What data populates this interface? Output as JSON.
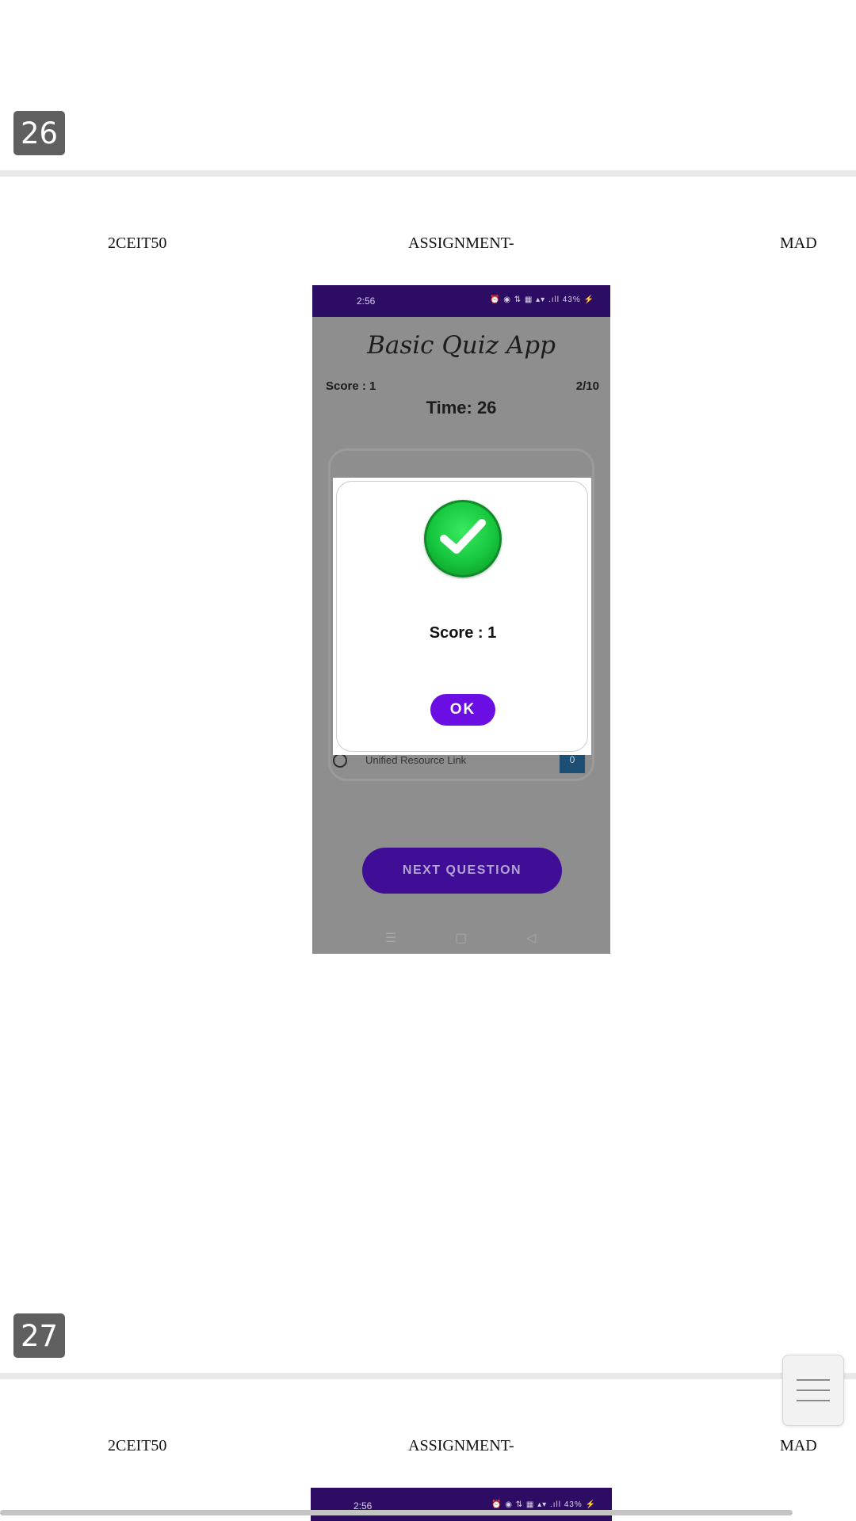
{
  "pages": [
    {
      "number": "26",
      "header": {
        "left": "2CEIT50",
        "center": "ASSIGNMENT-",
        "right": "MAD"
      }
    },
    {
      "number": "27",
      "header": {
        "left": "2CEIT50",
        "center": "ASSIGNMENT-",
        "right": "MAD"
      }
    }
  ],
  "screenshot1": {
    "status_time": "2:56",
    "status_icons": "⏰ ◉ ⇅ ▦ ▴▾ .ıll 43% ⚡",
    "app_title": "Basic Quiz App",
    "score_label": "Score : 1",
    "progress": "2/10",
    "timer": "Time: 26",
    "last_option": {
      "text": "Unified Resource Link",
      "tag": "0"
    },
    "next_button": "NEXT QUESTION",
    "nav_icons": {
      "menu": "☰",
      "home": "▢",
      "back": "◁"
    },
    "dialog": {
      "icon": "check-icon",
      "score": "Score : 1",
      "ok_label": "OK"
    }
  },
  "screenshot2": {
    "status_time": "2:56",
    "status_icons": "⏰ ◉ ⇅ ▦ ▴▾ .ıll 43% ⚡"
  },
  "colors": {
    "status_bar": "#2d0d63",
    "primary_button": "#6b0ee3",
    "check_green": "#16c63c"
  }
}
